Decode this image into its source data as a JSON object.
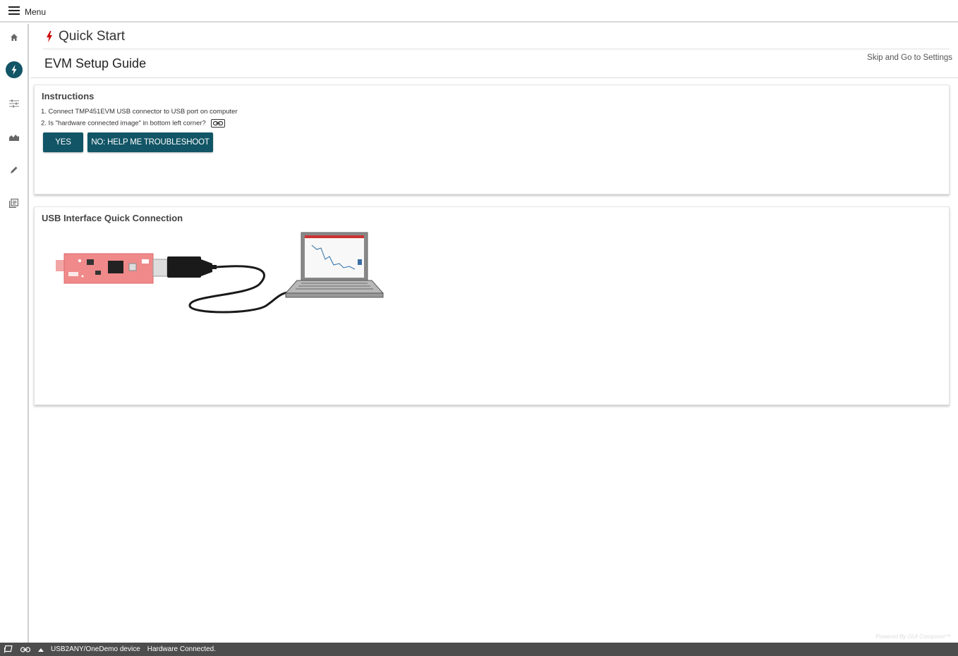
{
  "topbar": {
    "menu_label": "Menu"
  },
  "sidebar": {
    "items": [
      {
        "icon": "home-icon"
      },
      {
        "icon": "quick-start-icon",
        "active": true
      },
      {
        "icon": "sliders-icon"
      },
      {
        "icon": "chart-icon"
      },
      {
        "icon": "pencil-icon"
      },
      {
        "icon": "collateral-icon"
      }
    ]
  },
  "header": {
    "title": "Quick Start"
  },
  "guide": {
    "title": "EVM Setup Guide",
    "skip_label": "Skip and Go to Settings"
  },
  "instructions": {
    "title": "Instructions",
    "step1": "1. Connect TMP451EVM USB connector to USB port on computer",
    "step2": "2. Is \"hardware connected image\" in bottom left corner?",
    "yes_label": "YES",
    "no_label": "NO: HELP ME TROUBLESHOOT"
  },
  "usb_card": {
    "title": "USB Interface Quick Connection"
  },
  "statusbar": {
    "device": "USB2ANY/OneDemo device",
    "status": "Hardware Connected."
  },
  "footer": {
    "powered_by": "Powered By GUI Composer™"
  },
  "colors": {
    "accent": "#115566",
    "brand_red": "#cc0000",
    "statusbar": "#4d4d4d"
  }
}
